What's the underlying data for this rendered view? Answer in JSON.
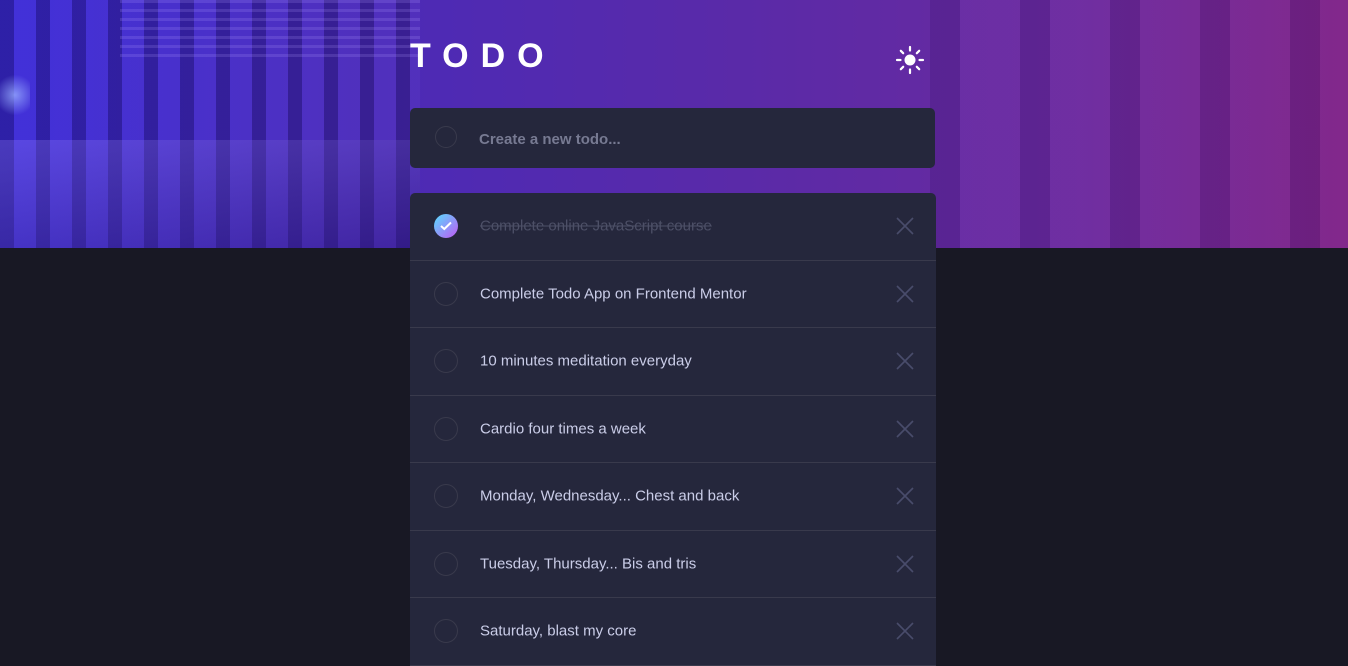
{
  "app": {
    "title": "TODO",
    "theme_toggle_icon": "sun-icon"
  },
  "new_todo": {
    "placeholder": "Create a new todo..."
  },
  "todos": [
    {
      "text": "Complete online JavaScript course",
      "completed": true
    },
    {
      "text": "Complete Todo App on Frontend Mentor",
      "completed": false
    },
    {
      "text": "10 minutes meditation everyday",
      "completed": false
    },
    {
      "text": "Cardio four times a week",
      "completed": false
    },
    {
      "text": "Monday, Wednesday... Chest and back",
      "completed": false
    },
    {
      "text": "Tuesday, Thursday... Bis and tris",
      "completed": false
    },
    {
      "text": "Saturday, blast my core",
      "completed": false
    }
  ],
  "colors": {
    "page_background": "#181824",
    "card_background": "#25273c",
    "text": "#cacde8",
    "completed_text": "#4d5067",
    "check_gradient_start": "#57ddff",
    "check_gradient_end": "#c058f3"
  }
}
